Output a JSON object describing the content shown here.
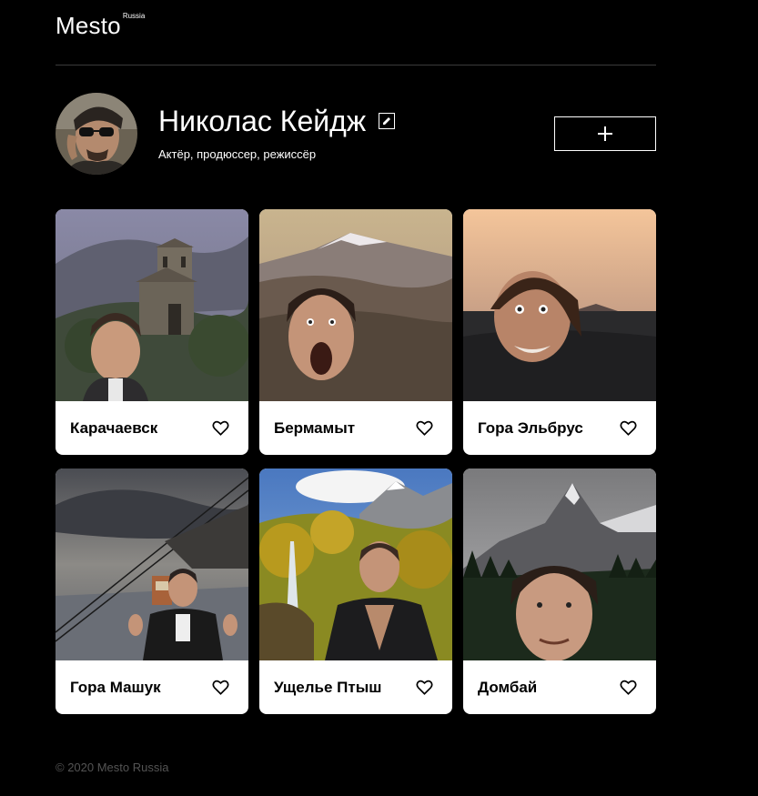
{
  "header": {
    "logo_main": "Mesto",
    "logo_sup": "Russia"
  },
  "profile": {
    "name": "Николас Кейдж",
    "about": "Актёр, продюссер, режиссёр",
    "edit_icon": "pencil-icon",
    "add_icon": "plus-icon"
  },
  "cards": [
    {
      "title": "Карачаевск",
      "like_icon": "heart-icon"
    },
    {
      "title": "Бермамыт",
      "like_icon": "heart-icon"
    },
    {
      "title": "Гора Эльбрус",
      "like_icon": "heart-icon"
    },
    {
      "title": "Гора Машук",
      "like_icon": "heart-icon"
    },
    {
      "title": "Ущелье Птыш",
      "like_icon": "heart-icon"
    },
    {
      "title": "Домбай",
      "like_icon": "heart-icon"
    }
  ],
  "footer": {
    "copyright": "© 2020 Mesto Russia"
  },
  "colors": {
    "background": "#000000",
    "card_background": "#ffffff",
    "footer_text": "#545454"
  }
}
